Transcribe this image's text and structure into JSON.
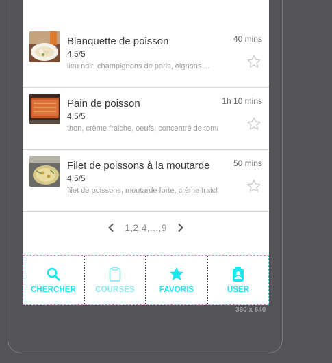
{
  "recipes": [
    {
      "title": "Blanquette de poisson",
      "rating": "4,5/5",
      "ingredients": "lieu noir, champignons de paris, oignons ...",
      "time": "40 mins",
      "thumb_icon": "blanquette-dish-photo"
    },
    {
      "title": "Pain de poisson",
      "rating": "4,5/5",
      "ingredients": "thon, crème fraiche, oeufs, concentré de tomates ...",
      "time": "1h 10 mins",
      "thumb_icon": "fish-loaf-photo"
    },
    {
      "title": "Filet de poissons à la moutarde",
      "rating": "4,5/5",
      "ingredients": "filet de poissons, moutarde forte, crème fraiche ...",
      "time": "50 mins",
      "thumb_icon": "fish-mustard-photo"
    }
  ],
  "pagination": {
    "text": "1,2,4,...,9",
    "prev_icon": "chevron-left-icon",
    "next_icon": "chevron-right-icon"
  },
  "bottom_nav": {
    "items": [
      {
        "label": "CHERCHER",
        "icon": "search-icon"
      },
      {
        "label": "COURSES",
        "icon": "clipboard-icon"
      },
      {
        "label": "FAVORIS",
        "icon": "star-icon"
      },
      {
        "label": "USER",
        "icon": "user-badge-icon"
      }
    ]
  },
  "device_size_label": "360 x 640",
  "colors": {
    "background": "#545357",
    "screen": "#ffffff",
    "accent": "#1ee6ee",
    "nav_border": "#3fd1cf"
  }
}
